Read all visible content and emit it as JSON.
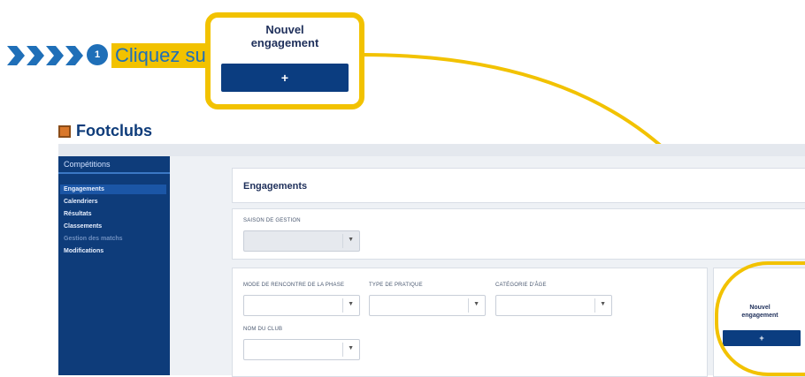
{
  "instruction": {
    "step_number": "1",
    "text": "Cliquez sur"
  },
  "callout": {
    "title_line1": "Nouvel",
    "title_line2": "engagement",
    "button_label": "+"
  },
  "app": {
    "name": "Footclubs",
    "sidebar": {
      "section": "Compétitions",
      "items": [
        "Engagements",
        "Calendriers",
        "Résultats",
        "Classements",
        "Gestion des matchs",
        "Modifications"
      ]
    },
    "page_title": "Engagements",
    "filters": {
      "season_label": "SAISON DE GESTION",
      "label1": "MODE DE RENCONTRE DE LA PHASE",
      "label2": "TYPE DE PRATIQUE",
      "label3": "CATÉGORIE D'ÂGE",
      "label4": "NOM DU CLUB"
    },
    "new_engagement": {
      "title_line1": "Nouvel",
      "title_line2": "engagement",
      "button_label": "+"
    }
  },
  "colors": {
    "highlight": "#f2c200",
    "primary": "#0e3c7a",
    "button": "#0b3d80",
    "accent_blue": "#1f6fb8"
  }
}
